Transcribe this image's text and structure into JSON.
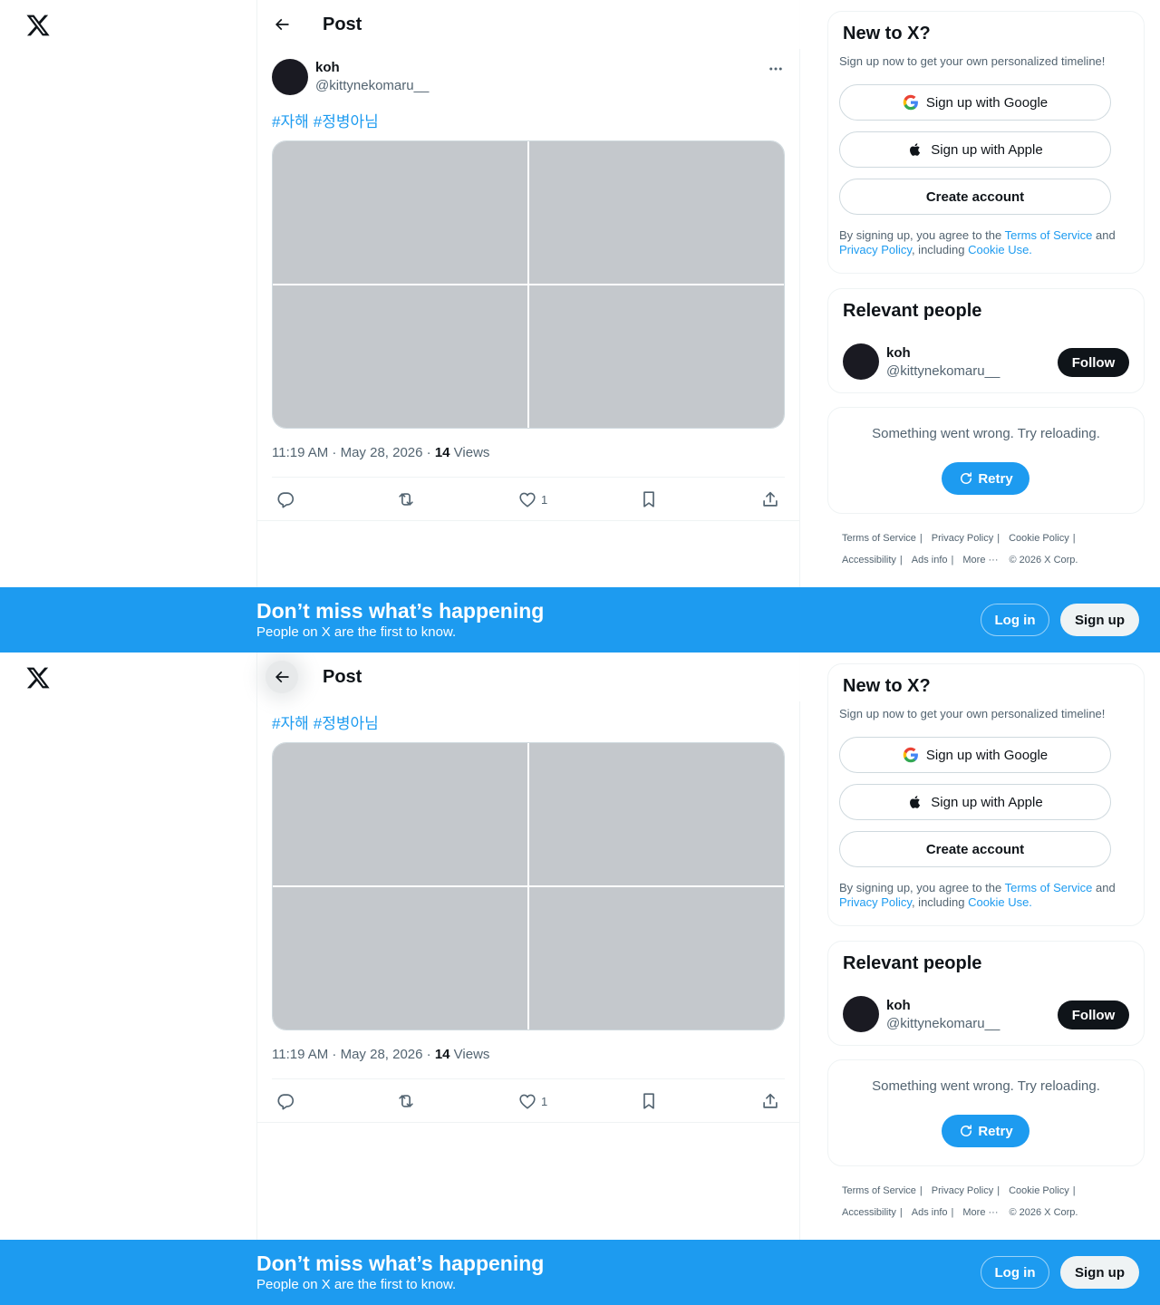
{
  "header": {
    "title": "Post",
    "back_icon": "arrow-left-icon"
  },
  "post": {
    "author_name": "koh",
    "author_handle": "@kittynekomaru__",
    "hashtags": [
      "#자해",
      "#정병아님"
    ],
    "timestamp": "11:19 AM · May 28, 2026 · ",
    "views_count": "14",
    "views_label": " Views",
    "like_count": "1",
    "media_count": 4
  },
  "signup_card": {
    "title": "New to X?",
    "subtitle": "Sign up now to get your own personalized timeline!",
    "google_label": "Sign up with Google",
    "apple_label": "Sign up with Apple",
    "create_label": "Create account",
    "legal_prefix": "By signing up, you agree to the ",
    "terms_link": "Terms of Service",
    "and_text": " and ",
    "privacy_link": "Privacy Policy",
    "including_text": ", including ",
    "cookie_link": "Cookie Use."
  },
  "relevant_people": {
    "title": "Relevant people",
    "name": "koh",
    "handle": "@kittynekomaru__",
    "follow_label": "Follow"
  },
  "error_card": {
    "message": "Something went wrong. Try reloading.",
    "retry_label": "Retry"
  },
  "footer": {
    "terms": "Terms of Service",
    "privacy": "Privacy Policy",
    "cookie": "Cookie Policy",
    "accessibility": "Accessibility",
    "ads": "Ads info",
    "more": "More ···",
    "copyright": "© 2026 X Corp."
  },
  "banner": {
    "title": "Don’t miss what’s happening",
    "subtitle": "People on X are the first to know.",
    "login_label": "Log in",
    "signup_label": "Sign up"
  },
  "colors": {
    "accent": "#1d9bf0",
    "text": "#0f1419",
    "muted": "#536471",
    "border": "#eff3f4"
  }
}
